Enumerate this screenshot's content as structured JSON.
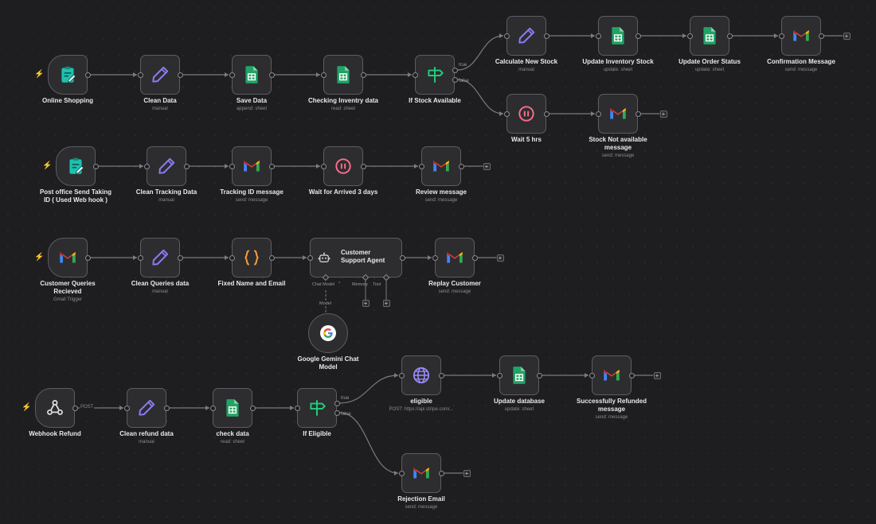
{
  "nodes": {
    "online_shopping": {
      "label": "Online Shopping",
      "icon": "form-icon"
    },
    "clean_data": {
      "label": "Clean Data",
      "sub": "manual",
      "icon": "pencil-icon"
    },
    "save_data": {
      "label": "Save Data",
      "sub": "append: sheet",
      "icon": "google-sheets-icon"
    },
    "checking_inventory": {
      "label": "Checking Inventry data",
      "sub": "read: sheet",
      "icon": "google-sheets-icon"
    },
    "if_stock": {
      "label": "If Stock Available",
      "icon": "if-sign-icon",
      "true_label": "true",
      "false_label": "false"
    },
    "calculate_stock": {
      "label": "Calculate New Stock",
      "sub": "manual",
      "icon": "pencil-icon"
    },
    "update_inventory": {
      "label": "Update Inventory Stock",
      "sub": "update: sheet",
      "icon": "google-sheets-icon"
    },
    "update_order": {
      "label": "Update Order Status",
      "sub": "update: sheet",
      "icon": "google-sheets-icon"
    },
    "confirmation": {
      "label": "Confirmation Message",
      "sub": "send: message",
      "icon": "gmail-icon"
    },
    "wait_5": {
      "label": "Wait 5 hrs",
      "icon": "pause-icon"
    },
    "stock_not_available": {
      "label": "Stock Not available message",
      "sub": "send: message",
      "icon": "gmail-icon"
    },
    "post_office": {
      "label": "Post office Send Taking ID ( Used Web hook )",
      "icon": "form-icon"
    },
    "clean_tracking": {
      "label": "Clean Tracking Data",
      "sub": "manual",
      "icon": "pencil-icon"
    },
    "tracking_msg": {
      "label": "Tracking ID message",
      "sub": "send: message",
      "icon": "gmail-icon"
    },
    "wait_3": {
      "label": "Wait for Arrived 3 days",
      "icon": "pause-icon"
    },
    "review_msg": {
      "label": "Review message",
      "sub": "send: message",
      "icon": "gmail-icon"
    },
    "customer_queries": {
      "label": "Customer Queries Recieved",
      "sub": "Gmail Trigger",
      "icon": "gmail-icon"
    },
    "clean_queries": {
      "label": "Clean Queries data",
      "sub": "manual",
      "icon": "pencil-icon"
    },
    "fixed_name": {
      "label": "Fixed Name and Email",
      "icon": "code-braces-icon"
    },
    "support_agent": {
      "label": "Customer Support Agent",
      "icon": "robot-icon",
      "chat_model": "Chat Model",
      "memory": "Memory",
      "tool": "Tool",
      "model_label": "Model"
    },
    "replay_customer": {
      "label": "Replay Customer",
      "sub": "send: message",
      "icon": "gmail-icon"
    },
    "gemini": {
      "label": "Google Gemini Chat Model",
      "icon": "google-icon"
    },
    "webhook_refund": {
      "label": "Webhook Refund",
      "icon": "webhook-icon",
      "post_label": "POST"
    },
    "clean_refund": {
      "label": "Clean refund data",
      "sub": "manual",
      "icon": "pencil-icon"
    },
    "check_data": {
      "label": "check data",
      "sub": "read: sheet",
      "icon": "google-sheets-icon"
    },
    "if_eligible": {
      "label": "If Eligible",
      "icon": "if-sign-icon",
      "true_label": "true",
      "false_label": "false"
    },
    "eligible": {
      "label": "eligible",
      "sub": "POST: https://api.stripe.com/...",
      "icon": "globe-icon"
    },
    "update_database": {
      "label": "Update database",
      "sub": "update: sheet",
      "icon": "google-sheets-icon"
    },
    "refunded_msg": {
      "label": "Successfully Refunded message",
      "sub": "send: message",
      "icon": "gmail-icon"
    },
    "rejection": {
      "label": "Rejection Email",
      "sub": "send: message",
      "icon": "gmail-icon"
    }
  },
  "colors": {
    "background": "#1e1e20",
    "node_fill": "#2d2d30",
    "node_border": "#5c5c62",
    "edge": "#7a7a80",
    "trigger_bolt": "#ff5470",
    "sheets_green": "#21a366",
    "pencil_purple": "#8b7cf6",
    "wait_pink": "#ff6d8a",
    "code_orange": "#ff9f3a"
  }
}
